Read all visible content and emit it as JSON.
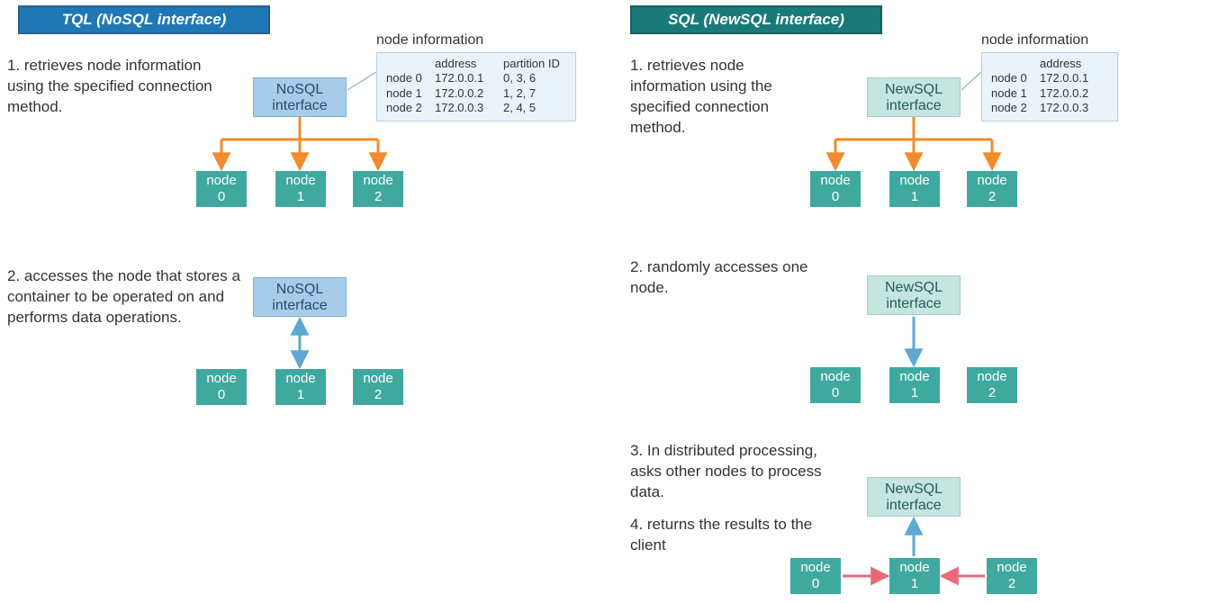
{
  "titles": {
    "tql": "TQL (NoSQL interface)",
    "sql": "SQL (NewSQL interface)"
  },
  "tql": {
    "step1": "1. retrieves node information using the specified connection method.",
    "step2": "2. accesses the node that stores a container to be operated on and performs data operations.",
    "iface_label": "NoSQL interface",
    "info_label": "node information",
    "info_headers": {
      "address": "address",
      "partition": "partition ID"
    },
    "info_rows": [
      {
        "node": "node 0",
        "address": "172.0.0.1",
        "partition": "0, 3, 6"
      },
      {
        "node": "node 1",
        "address": "172.0.0.2",
        "partition": "1, 2, 7"
      },
      {
        "node": "node 2",
        "address": "172.0.0.3",
        "partition": "2, 4, 5"
      }
    ],
    "nodes": [
      "node 0",
      "node 1",
      "node 2"
    ]
  },
  "sql": {
    "step1": "1. retrieves node information using the specified connection method.",
    "step2": "2. randomly accesses one node.",
    "step3": "3. In distributed processing, asks other nodes to process data.",
    "step4": "4. returns the results to the client",
    "iface_label": "NewSQL interface",
    "info_label": "node information",
    "info_headers": {
      "address": "address"
    },
    "info_rows": [
      {
        "node": "node 0",
        "address": "172.0.0.1"
      },
      {
        "node": "node 1",
        "address": "172.0.0.2"
      },
      {
        "node": "node 2",
        "address": "172.0.0.3"
      }
    ],
    "nodes": [
      "node 0",
      "node 1",
      "node 2"
    ]
  },
  "colors": {
    "orange": "#f08c2e",
    "blue": "#5fa8d3",
    "red": "#e86a7a"
  }
}
